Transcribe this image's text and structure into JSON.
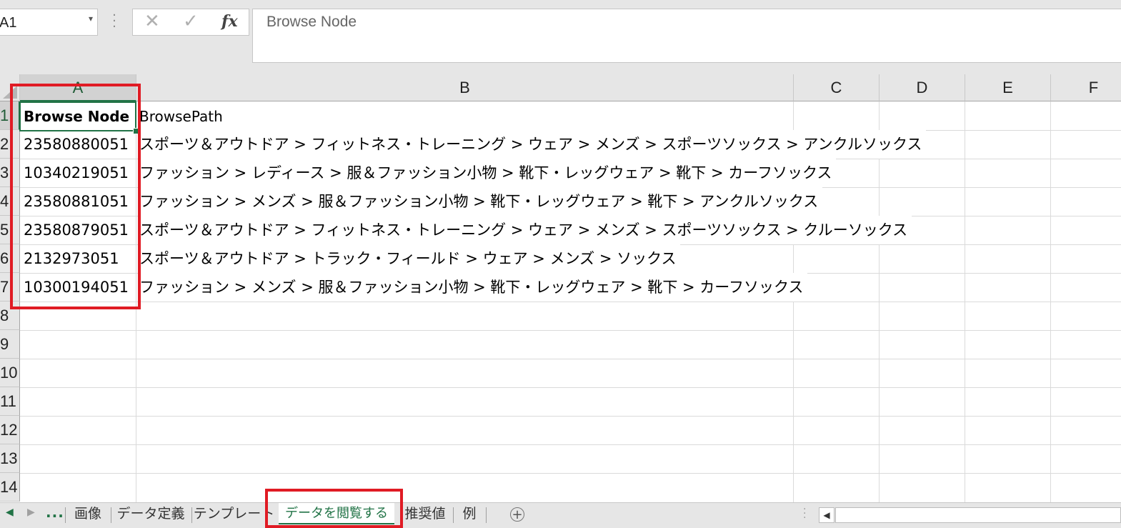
{
  "formula_bar": {
    "name_box": "A1",
    "formula": "Browse Node"
  },
  "columns": [
    "A",
    "B",
    "C",
    "D",
    "E",
    "F"
  ],
  "rows": [
    "1",
    "2",
    "3",
    "4",
    "5",
    "6",
    "7",
    "8",
    "9",
    "10",
    "11",
    "12",
    "13",
    "14"
  ],
  "header": {
    "a": "Browse Node",
    "b": "BrowsePath"
  },
  "data_rows": [
    {
      "node": "23580880051",
      "path": "スポーツ＆アウトドア > フィットネス・トレーニング > ウェア > メンズ > スポーツソックス > アンクルソックス"
    },
    {
      "node": "10340219051",
      "path": "ファッション > レディース > 服＆ファッション小物 > 靴下・レッグウェア > 靴下 > カーフソックス"
    },
    {
      "node": "23580881051",
      "path": "ファッション > メンズ > 服＆ファッション小物 > 靴下・レッグウェア > 靴下 > アンクルソックス"
    },
    {
      "node": "23580879051",
      "path": "スポーツ＆アウトドア > フィットネス・トレーニング > ウェア > メンズ > スポーツソックス > クルーソックス"
    },
    {
      "node": "2132973051",
      "path": "スポーツ＆アウトドア > トラック・フィールド > ウェア > メンズ > ソックス"
    },
    {
      "node": "10300194051",
      "path": "ファッション > メンズ > 服＆ファッション小物 > 靴下・レッグウェア > 靴下 > カーフソックス"
    }
  ],
  "sheet_tabs": {
    "more": "...",
    "items": [
      "画像",
      "データ定義",
      "テンプレート",
      "データを閲覧する",
      "推奨値",
      "例"
    ],
    "active": "データを閲覧する"
  },
  "colors": {
    "accent": "#217346",
    "highlight_box": "#e01b24"
  }
}
